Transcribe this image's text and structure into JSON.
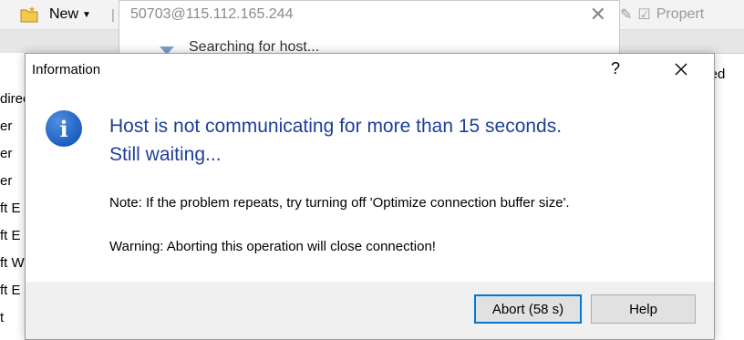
{
  "toolbar": {
    "new_label": "New",
    "right_label": "Propert"
  },
  "left_list": [
    "direc",
    "er",
    "er",
    "er",
    "ft E",
    "ft E",
    "ft W",
    "ft E",
    "t"
  ],
  "right_column_label": "nged",
  "search_dialog": {
    "title": "50703@115.112.165.244",
    "status": "Searching for host..."
  },
  "dialog": {
    "title": "Information",
    "help_symbol": "?",
    "message_line1": "Host is not communicating for more than 15 seconds.",
    "message_line2": "Still waiting...",
    "note": "Note: If the problem repeats, try turning off 'Optimize connection buffer size'.",
    "warning": "Warning: Aborting this operation will close connection!",
    "abort_label": "Abort (58 s)",
    "help_label": "Help"
  },
  "colors": {
    "heading": "#1e3f9a",
    "accent_border": "#0078d7",
    "footer_bg": "#f0f0f0"
  }
}
